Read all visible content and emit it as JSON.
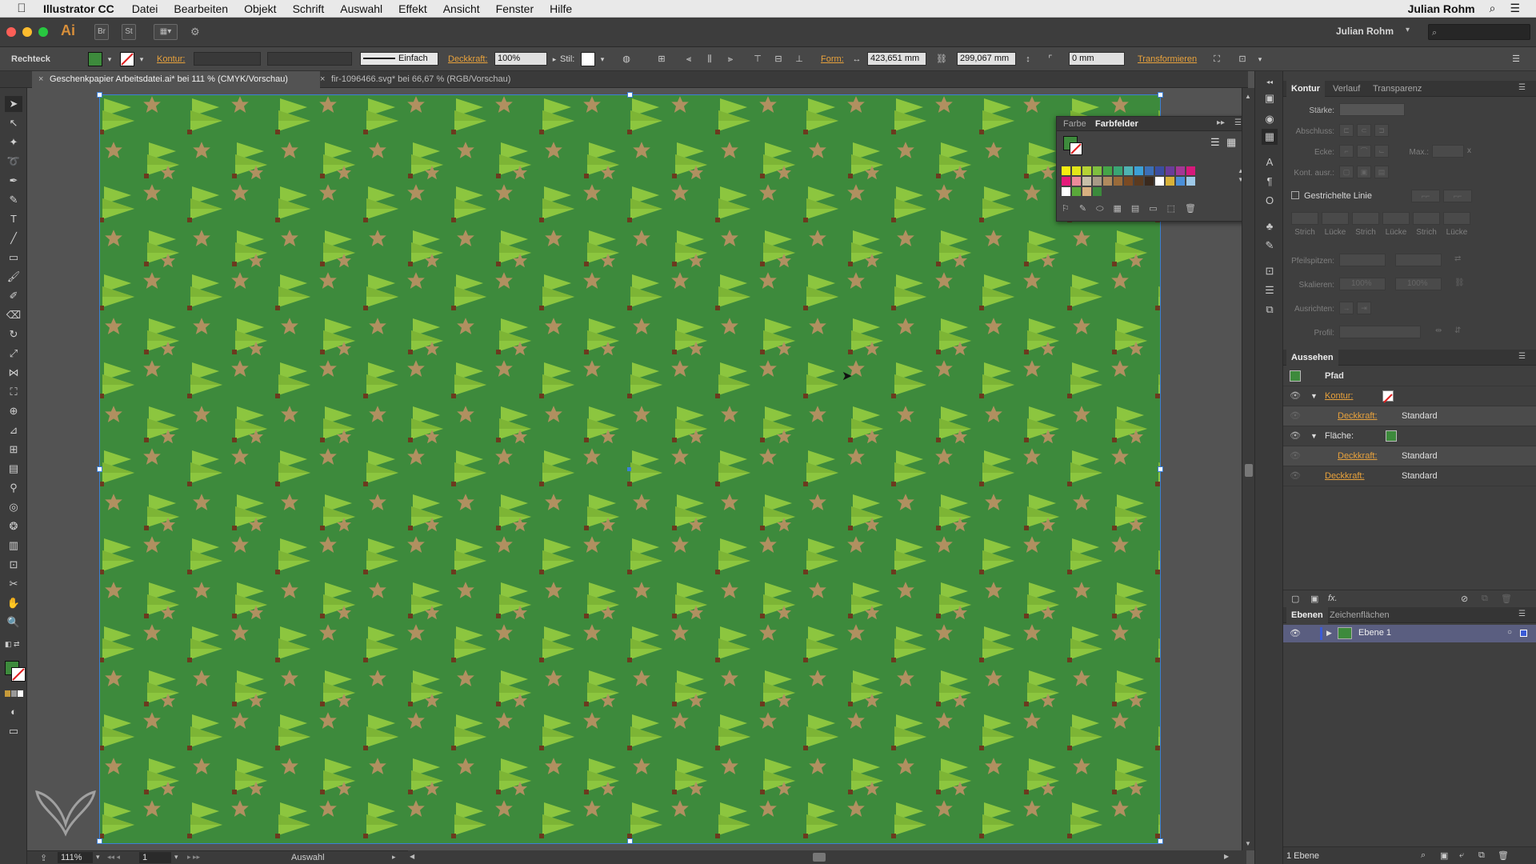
{
  "menubar": {
    "app_name": "Illustrator CC",
    "items": [
      "Datei",
      "Bearbeiten",
      "Objekt",
      "Schrift",
      "Auswahl",
      "Effekt",
      "Ansicht",
      "Fenster",
      "Hilfe"
    ],
    "user": "Julian Rohm"
  },
  "appbar": {
    "logo": "Ai",
    "bridge": "Br",
    "stock": "St",
    "workspace_user": "Julian Rohm",
    "search_placeholder": ""
  },
  "controlbar": {
    "object_type": "Rechteck",
    "kontur_label": "Kontur:",
    "stroke_style": "Einfach",
    "deckkraft_label": "Deckkraft:",
    "deckkraft_value": "100%",
    "stil_label": "Stil:",
    "form_label": "Form:",
    "width_value": "423,651 mm",
    "height_value": "299,067 mm",
    "corner_value": "0 mm",
    "transform_label": "Transformieren"
  },
  "tabs": [
    {
      "label": "Geschenkpapier Arbeitsdatei.ai* bei 111 % (CMYK/Vorschau)",
      "active": true
    },
    {
      "label": "fir-1096466.svg* bei 66,67 % (RGB/Vorschau)",
      "active": false
    }
  ],
  "swatches": {
    "tabs": [
      "Farbe",
      "Farbfelder"
    ],
    "colors": [
      [
        "#f7ec11",
        "#e2e519",
        "#b6d334",
        "#7fbf3f",
        "#46a548",
        "#3aa574",
        "#4fb3b3",
        "#3da0d6",
        "#3c6fb6",
        "#3a4ea0",
        "#6a3d9a",
        "#a43795",
        "#d6197b"
      ],
      [
        "#e5197a",
        "#ec8a9a",
        "#c8bfa8",
        "#a89a86",
        "#b08a5e",
        "#9a6b3a",
        "#7a4a23",
        "#5a3a1f",
        "#3a2a1e",
        "#ffffff",
        "#d8b23a",
        "#4a8fd8",
        "#9ec9e8"
      ],
      [
        "#ffffff",
        "#5aa83a",
        "#d8b080",
        "#3c8a3c"
      ]
    ]
  },
  "kontur_panel": {
    "tabs": [
      "Kontur",
      "Verlauf",
      "Transparenz"
    ],
    "staerke_label": "Stärke:",
    "abschluss_label": "Abschluss:",
    "ecke_label": "Ecke:",
    "max_label": "Max.:",
    "kont_ausr_label": "Kont. ausr.:",
    "dashed_label": "Gestrichelte Linie",
    "dash_labels": [
      "Strich",
      "Lücke",
      "Strich",
      "Lücke",
      "Strich",
      "Lücke"
    ],
    "pfeilspitzen_label": "Pfeilspitzen:",
    "skalieren_label": "Skalieren:",
    "skalieren_values": [
      "100%",
      "100%"
    ],
    "ausrichten_label": "Ausrichten:",
    "profil_label": "Profil:"
  },
  "aussehen_panel": {
    "title": "Aussehen",
    "path_label": "Pfad",
    "kontur_label": "Kontur:",
    "deckkraft1_label": "Deckkraft:",
    "deckkraft1_value": "Standard",
    "flaeche_label": "Fläche:",
    "deckkraft2_label": "Deckkraft:",
    "deckkraft2_value": "Standard",
    "deckkraft3_label": "Deckkraft:",
    "deckkraft3_value": "Standard",
    "fx_label": "fx."
  },
  "ebenen_panel": {
    "tabs": [
      "Ebenen",
      "Zeichenflächen"
    ],
    "layer_name": "Ebene 1",
    "footer_count": "1 Ebene"
  },
  "statusbar": {
    "zoom": "111%",
    "artboard_number": "1",
    "status_text": "Auswahl"
  },
  "colors": {
    "pattern_background": "#3d8a3c",
    "tree_light": "#8cc63f",
    "tree_dark": "#6aaa2e",
    "trunk": "#6b3a1e",
    "star": "#b09060",
    "accent_orange": "#e8a23c",
    "selection_blue": "#3b7fd6"
  }
}
